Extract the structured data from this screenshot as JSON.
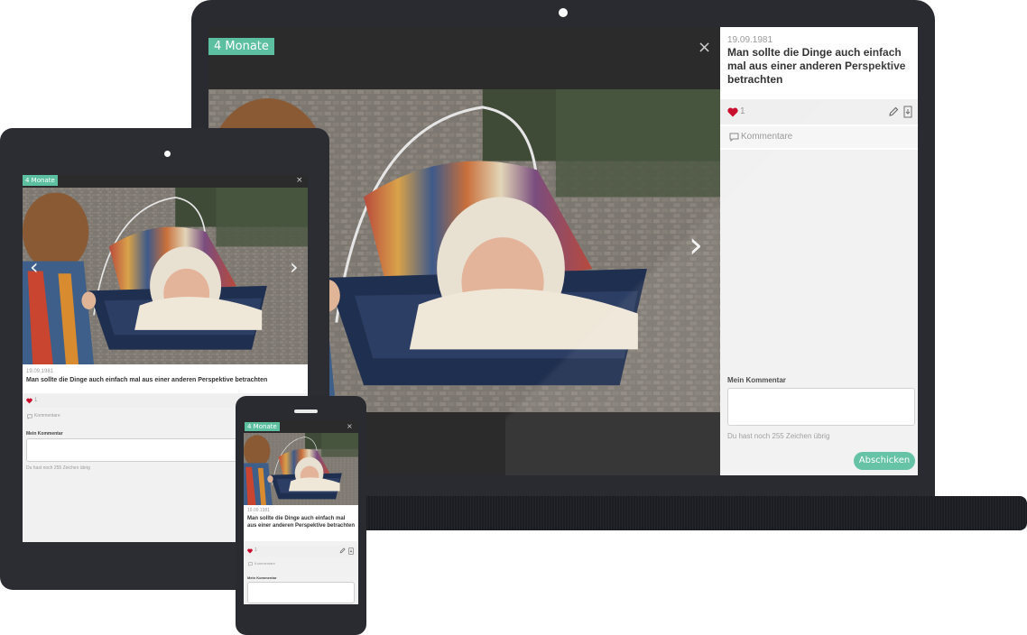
{
  "gallery": {
    "age_tag": "4 Monate",
    "close_glyph": "×",
    "prev_glyph": "‹",
    "next_glyph": "›"
  },
  "post": {
    "date": "19.09.1981",
    "title": "Man sollte die Dinge auch einfach mal aus einer anderen Perspektive betrachten",
    "likes": "1",
    "comments_label": "Kommentare",
    "my_comment_label": "Mein Kommentar",
    "chars_left": "Du hast noch 255 Zeichen übrig",
    "submit_label": "Abschicken"
  },
  "colors": {
    "accent": "#5cbfa0",
    "heart": "#c8102e",
    "device": "#2a2b30"
  },
  "icons": [
    "heart-icon",
    "pencil-icon",
    "download-icon",
    "speech-bubble-icon",
    "close-icon",
    "chevron-left-icon",
    "chevron-right-icon"
  ]
}
